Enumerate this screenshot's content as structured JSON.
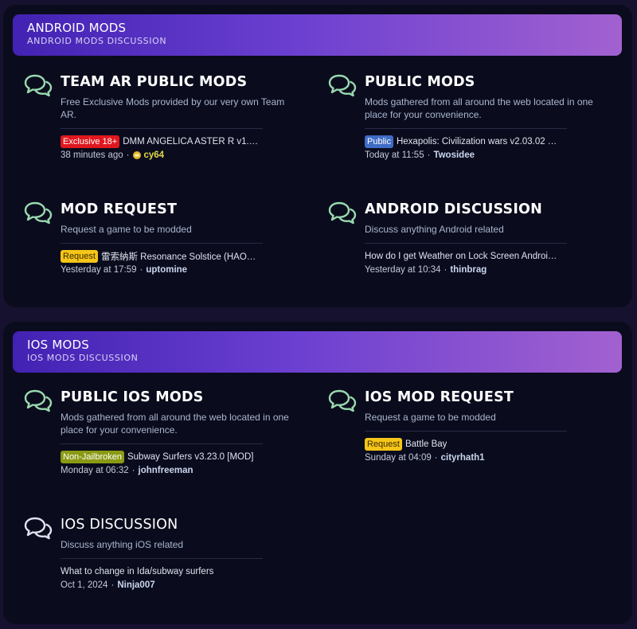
{
  "categories": [
    {
      "title": "ANDROID MODS",
      "subtitle": "ANDROID MODS DISCUSSION",
      "nodes": [
        {
          "title": "TEAM AR PUBLIC MODS",
          "description": "Free Exclusive Mods provided by our very own Team AR.",
          "badge": "Exclusive 18+",
          "last_thread": "DMM ANGELICA ASTER R v1.…",
          "time": "38 minutes ago",
          "user": "cy64",
          "icon": "chat-bubbles-icon"
        },
        {
          "title": "PUBLIC MODS",
          "description": "Mods gathered from all around the web located in one place for your convenience.",
          "badge": "Public",
          "last_thread": "Hexapolis: Civilization wars v2.03.02 …",
          "time": "Today at 11:55",
          "user": "Twosidee",
          "icon": "chat-bubbles-icon"
        },
        {
          "title": "MOD REQUEST",
          "description": "Request a game to be modded",
          "badge": "Request",
          "last_thread": "雷索納斯 Resonance Solstice (HAO…",
          "time": "Yesterday at 17:59",
          "user": "uptomine",
          "icon": "chat-bubbles-icon"
        },
        {
          "title": "ANDROID DISCUSSION",
          "description": "Discuss anything Android related",
          "last_thread": "How do I get Weather on Lock Screen Androi…",
          "time": "Yesterday at 10:34",
          "user": "thinbrag",
          "icon": "chat-bubbles-icon"
        }
      ]
    },
    {
      "title": "IOS MODS",
      "subtitle": "IOS MODS DISCUSSION",
      "nodes": [
        {
          "title": "PUBLIC IOS MODS",
          "description": "Mods gathered from all around the web located in one place for your convenience.",
          "badge": "Non-Jailbroken",
          "last_thread": "Subway Surfers v3.23.0 [MOD]",
          "time": "Monday at 06:32",
          "user": "johnfreeman",
          "icon": "chat-bubbles-icon"
        },
        {
          "title": "IOS MOD REQUEST",
          "description": "Request a game to be modded",
          "badge": "Request",
          "last_thread": "Battle Bay",
          "time": "Sunday at 04:09",
          "user": "cityrhath1",
          "icon": "chat-bubbles-icon"
        },
        {
          "title": "IOS DISCUSSION",
          "description": "Discuss anything iOS related",
          "last_thread": "What to change in Ida/subway surfers",
          "time": "Oct 1, 2024",
          "user": "Ninja007",
          "icon": "chat-bubbles-outline-icon"
        }
      ]
    }
  ],
  "meta_separator": "·",
  "colors": {
    "page_bg": "#16112e",
    "panel_bg": "#0a0c1d",
    "header_gradient_start": "#4222b3",
    "header_gradient_end": "#a261d0",
    "icon_green": "#9ad9b0",
    "icon_outline": "#dfe3ef",
    "badge_exclusive": "#e0171f",
    "badge_request": "#f5c518",
    "badge_public": "#3f6cc6",
    "badge_nonjailbroken": "#8a9a13"
  }
}
